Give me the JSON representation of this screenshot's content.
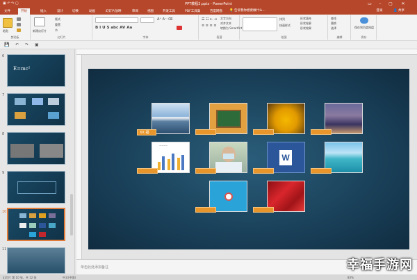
{
  "window": {
    "title": "PPT教程2.pptx - PowerPoint"
  },
  "tabs": [
    "文件",
    "开始",
    "插入",
    "设计",
    "切换",
    "动画",
    "幻灯片放映",
    "审阅",
    "视图",
    "开发工具",
    "PDF工具集",
    "百度网盘"
  ],
  "active_tab": "开始",
  "search_placeholder": "告诉我你想要做什么...",
  "user_label": "登录",
  "share_label": "共享",
  "ribbon": {
    "groups": [
      "剪贴板",
      "幻灯片",
      "字体",
      "段落",
      "绘图",
      "编辑",
      "保存"
    ],
    "paste": "粘贴",
    "new_slide": "新建幻灯片",
    "layout": "版式",
    "reset": "重置",
    "section": "节",
    "text_direction": "文字方向",
    "align_text": "对齐文本",
    "convert_smartart": "转换为 SmartArt",
    "arrange": "排列",
    "quick_styles": "快速样式",
    "shape_fill": "形状填充",
    "shape_outline": "形状轮廓",
    "shape_effects": "形状效果",
    "find": "查找",
    "replace": "替换",
    "select": "选择",
    "save_to": "保存到百度网盘"
  },
  "thumbnails": [
    {
      "num": "6",
      "label": "E=mc²"
    },
    {
      "num": "7",
      "label": ""
    },
    {
      "num": "8",
      "label": ""
    },
    {
      "num": "9",
      "label": ""
    },
    {
      "num": "10",
      "label": ""
    },
    {
      "num": "11",
      "label": ""
    }
  ],
  "slide": {
    "tag_text": "XX 福"
  },
  "notes_placeholder": "单击此处添加备注",
  "status": {
    "slide_info": "幻灯片 第 10 张，共 12 张",
    "lang": "中文(中国)",
    "zoom": "83%"
  },
  "watermark": "幸福手游网",
  "colors": {
    "accent": "#b7472a",
    "tag": "#e8962b",
    "slide_bg": "#173b53"
  }
}
